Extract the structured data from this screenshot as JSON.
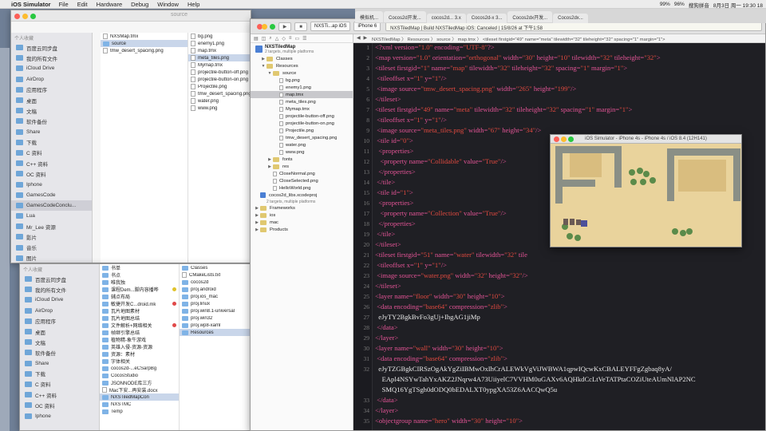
{
  "menubar": {
    "app_name": "iOS Simulator",
    "items": [
      "File",
      "Edit",
      "Hardware",
      "Debug",
      "Window",
      "Help"
    ],
    "status_right": [
      "99%",
      "96%",
      "搜狗拼音",
      "8月3日 周一 19:30 18"
    ]
  },
  "browser_tabs": [
    "模拟机...",
    "Cocos2d开发...",
    "cocos2d... 3.x",
    "Cocos2d-x 3...",
    "Cocos2dx开发...",
    "Cocos2dx..."
  ],
  "finder_top": {
    "title": "source",
    "sidebar_header": "个人收藏",
    "sidebar_items": [
      "百度云同步盘",
      "我的所有文件",
      "iCloud Drive",
      "AirDrop",
      "应用程序",
      "桌面",
      "文稿",
      "软件备份",
      "Share",
      "下载",
      "C 资料",
      "C++ 资料",
      "OC 资料",
      "Iphone",
      "GamesCode",
      "GamesCodeConclu...",
      "Lua",
      "Mr_Lee 资源",
      "影片",
      "音乐",
      "图片",
      "nixinsheng"
    ],
    "col1": [
      "NXSMap.tmx",
      "source",
      "tmw_desert_spacing.png"
    ],
    "col2": [
      "bg.png",
      "enemy1.png",
      "map.tmx",
      "meta_tiles.png",
      "Mymap.tmx",
      "projectile-button-off.png",
      "projectile-button-on.png",
      "Projectile.png",
      "tmw_desert_spacing.png",
      "water.png",
      "www.png"
    ]
  },
  "finder_bottom": {
    "sidebar_header": "个人收藏",
    "sidebar_items": [
      "百度云同步盘",
      "我的所有文件",
      "iCloud Drive",
      "AirDrop",
      "应用程序",
      "桌面",
      "文稿",
      "软件备份",
      "Share",
      "下载",
      "C 资料",
      "C++ 资料",
      "OC 资料",
      "Iphone"
    ],
    "col1": [
      "书单",
      "书点",
      "唯我独",
      "课程Dem...脚内容播哗",
      "辅点布局",
      "敏捷开发C...droid.mk",
      "瓦片地图素材",
      "瓦片地图总结",
      "文件解析+网络相关",
      "帧继引擎总结",
      "植物精-象牛游戏",
      "英雄入侵-资源-资源",
      "资源：素材",
      "字体相关",
      "cocos2d-...eCSarpBg",
      "CocosStudio",
      "JSONNODE库三方",
      "Mac下安...再安装.docx",
      "NXSTiledMapCon",
      "NXSTMC",
      "Temp"
    ],
    "col2": [
      "Classes",
      "CMakeLists.txt",
      "cocos2d",
      "proj.android",
      "proj.ios_mac",
      "proj.linux",
      "proj.win8.1-universal",
      "proj.win32",
      "proj.wp8-xaml",
      "Resources"
    ]
  },
  "xcode": {
    "scheme": "NXSTi...ap iOS",
    "device": "iPhone 6",
    "status": "NXSTiledMap  |  Build NXSTiledMap iOS: Canceled  |  15/8/26 at 下午1:58",
    "breadcrumb": "NXSTiledMap 〉 Resources 〉 source 〉 map.tmx 〉 <tileset firstgid=\"49\" name=\"meta\" tilewidth=\"32\" tileheight=\"32\" spacing=\"1\" margin=\"1\">",
    "project_name": "NXSTiledMap",
    "project_sub": "2 targets, multiple platforms",
    "nav": [
      {
        "label": "Classes",
        "depth": 1,
        "type": "folder",
        "open": false
      },
      {
        "label": "Resources",
        "depth": 1,
        "type": "folder",
        "open": true
      },
      {
        "label": "source",
        "depth": 2,
        "type": "folder",
        "open": true
      },
      {
        "label": "bg.png",
        "depth": 3,
        "type": "file"
      },
      {
        "label": "enemy1.png",
        "depth": 3,
        "type": "file"
      },
      {
        "label": "map.tmx",
        "depth": 3,
        "type": "file",
        "sel": true
      },
      {
        "label": "meta_tiles.png",
        "depth": 3,
        "type": "file"
      },
      {
        "label": "Mymap.tmx",
        "depth": 3,
        "type": "file"
      },
      {
        "label": "projectile-button-off.png",
        "depth": 3,
        "type": "file"
      },
      {
        "label": "projectile-button-on.png",
        "depth": 3,
        "type": "file"
      },
      {
        "label": "Projectile.png",
        "depth": 3,
        "type": "file"
      },
      {
        "label": "tmw_desert_spacing.png",
        "depth": 3,
        "type": "file"
      },
      {
        "label": "water.png",
        "depth": 3,
        "type": "file"
      },
      {
        "label": "www.png",
        "depth": 3,
        "type": "file"
      },
      {
        "label": "fonts",
        "depth": 2,
        "type": "folder",
        "open": false
      },
      {
        "label": "res",
        "depth": 2,
        "type": "folder",
        "open": false
      },
      {
        "label": "CloseNormal.png",
        "depth": 2,
        "type": "file"
      },
      {
        "label": "CloseSelected.png",
        "depth": 2,
        "type": "file"
      },
      {
        "label": "HelloWorld.png",
        "depth": 2,
        "type": "file"
      },
      {
        "label": "cocos2d_libs.xcodeproj",
        "depth": 0,
        "type": "project",
        "sub": "2 targets, multiple platforms"
      },
      {
        "label": "Frameworks",
        "depth": 0,
        "type": "folder",
        "open": false
      },
      {
        "label": "ios",
        "depth": 0,
        "type": "folder",
        "open": false
      },
      {
        "label": "mac",
        "depth": 0,
        "type": "folder",
        "open": false
      },
      {
        "label": "Products",
        "depth": 0,
        "type": "folder",
        "open": false
      }
    ],
    "code_lines": [
      {
        "n": "1",
        "h": "<span class='t'>&lt;?xml</span> <span class='a'>version=</span><span class='s'>\"1.0\"</span> <span class='a'>encoding=</span><span class='s'>\"UTF-8\"</span><span class='t'>?&gt;</span>"
      },
      {
        "n": "2",
        "h": "<span class='t'>&lt;map</span> <span class='a'>version=</span><span class='s'>\"1.0\"</span> <span class='a'>orientation=</span><span class='s'>\"orthogonal\"</span> <span class='a'>width=</span><span class='s'>\"30\"</span> <span class='a'>height=</span><span class='s'>\"10\"</span> <span class='a'>tilewidth=</span><span class='s'>\"32\"</span> <span class='a'>tileheight=</span><span class='s'>\"32\"</span><span class='t'>&gt;</span>"
      },
      {
        "n": "3",
        "h": "<span class='t'>&lt;tileset</span> <span class='a'>firstgid=</span><span class='s'>\"1\"</span> <span class='a'>name=</span><span class='s'>\"map\"</span> <span class='a'>tilewidth=</span><span class='s'>\"32\"</span> <span class='a'>tileheight=</span><span class='s'>\"32\"</span> <span class='a'>spacing=</span><span class='s'>\"1\"</span> <span class='a'>margin=</span><span class='s'>\"1\"</span><span class='t'>&gt;</span>"
      },
      {
        "n": "4",
        "h": "&nbsp;<span class='t'>&lt;tileoffset</span> <span class='a'>x=</span><span class='s'>\"1\"</span> <span class='a'>y=</span><span class='s'>\"1\"</span><span class='t'>/&gt;</span>"
      },
      {
        "n": "5",
        "h": "&nbsp;<span class='t'>&lt;image</span> <span class='a'>source=</span><span class='s'>\"tmw_desert_spacing.png\"</span> <span class='a'>width=</span><span class='s'>\"265\"</span> <span class='a'>height=</span><span class='s'>\"199\"</span><span class='t'>/&gt;</span>"
      },
      {
        "n": "6",
        "h": "<span class='t'>&lt;/tileset&gt;</span>"
      },
      {
        "n": "7",
        "h": "<span class='t'>&lt;tileset</span> <span class='a'>firstgid=</span><span class='s'>\"49\"</span> <span class='a'>name=</span><span class='s'>\"meta\"</span> <span class='a'>tilewidth=</span><span class='s'>\"32\"</span> <span class='a'>tileheight=</span><span class='s'>\"32\"</span> <span class='a'>spacing=</span><span class='s'>\"1\"</span> <span class='a'>margin=</span><span class='s'>\"1\"</span><span class='t'>&gt;</span>"
      },
      {
        "n": "8",
        "h": "&nbsp;<span class='t'>&lt;tileoffset</span> <span class='a'>x=</span><span class='s'>\"1\"</span> <span class='a'>y=</span><span class='s'>\"1\"</span><span class='t'>/&gt;</span>"
      },
      {
        "n": "9",
        "h": "&nbsp;<span class='t'>&lt;image</span> <span class='a'>source=</span><span class='s'>\"meta_tiles.png\"</span> <span class='a'>width=</span><span class='s'>\"67\"</span> <span class='a'>height=</span><span class='s'>\"34\"</span><span class='t'>/&gt;</span>"
      },
      {
        "n": "10",
        "h": "&nbsp;<span class='t'>&lt;tile</span> <span class='a'>id=</span><span class='s'>\"0\"</span><span class='t'>&gt;</span>"
      },
      {
        "n": "11",
        "h": "&nbsp;&nbsp;<span class='t'>&lt;properties&gt;</span>"
      },
      {
        "n": "12",
        "h": "&nbsp;&nbsp;&nbsp;<span class='t'>&lt;property</span> <span class='a'>name=</span><span class='s'>\"Collidable\"</span> <span class='a'>value=</span><span class='s'>\"True\"</span><span class='t'>/&gt;</span>"
      },
      {
        "n": "13",
        "h": "&nbsp;&nbsp;<span class='t'>&lt;/properties&gt;</span>"
      },
      {
        "n": "14",
        "h": "&nbsp;<span class='t'>&lt;/tile&gt;</span>"
      },
      {
        "n": "15",
        "h": "&nbsp;<span class='t'>&lt;tile</span> <span class='a'>id=</span><span class='s'>\"1\"</span><span class='t'>&gt;</span>"
      },
      {
        "n": "16",
        "h": "&nbsp;&nbsp;<span class='t'>&lt;properties&gt;</span>"
      },
      {
        "n": "17",
        "h": "&nbsp;&nbsp;&nbsp;<span class='t'>&lt;property</span> <span class='a'>name=</span><span class='s'>\"Collection\"</span> <span class='a'>value=</span><span class='s'>\"True\"</span><span class='t'>/&gt;</span>"
      },
      {
        "n": "18",
        "h": "&nbsp;&nbsp;<span class='t'>&lt;/properties&gt;</span>"
      },
      {
        "n": "19",
        "h": "&nbsp;<span class='t'>&lt;/tile&gt;</span>"
      },
      {
        "n": "20",
        "h": "<span class='t'>&lt;/tileset&gt;</span>"
      },
      {
        "n": "21",
        "h": "<span class='t'>&lt;tileset</span> <span class='a'>firstgid=</span><span class='s'>\"51\"</span> <span class='a'>name=</span><span class='s'>\"water\"</span> <span class='a'>tilewidth=</span><span class='s'>\"32\"</span> <span class='a'>tile</span>"
      },
      {
        "n": "22",
        "h": "&nbsp;<span class='t'>&lt;tileoffset</span> <span class='a'>x=</span><span class='s'>\"1\"</span> <span class='a'>y=</span><span class='s'>\"1\"</span><span class='t'>/&gt;</span>"
      },
      {
        "n": "23",
        "h": "&nbsp;<span class='t'>&lt;image</span> <span class='a'>source=</span><span class='s'>\"water.png\"</span> <span class='a'>width=</span><span class='s'>\"32\"</span> <span class='a'>height=</span><span class='s'>\"32\"</span><span class='t'>/&gt;</span>"
      },
      {
        "n": "24",
        "h": "<span class='t'>&lt;/tileset&gt;</span>"
      },
      {
        "n": "25",
        "h": "<span class='t'>&lt;layer</span> <span class='a'>name=</span><span class='s'>\"floor\"</span> <span class='a'>width=</span><span class='s'>\"30\"</span> <span class='a'>height=</span><span class='s'>\"10\"</span><span class='t'>&gt;</span>"
      },
      {
        "n": "26",
        "h": "&nbsp;<span class='t'>&lt;data</span> <span class='a'>encoding=</span><span class='s'>\"base64\"</span> <span class='a'>compression=</span><span class='s'>\"zlib\"</span><span class='t'>&gt;</span>"
      },
      {
        "n": "27",
        "h": "&nbsp;&nbsp;<span class='p'>eJyTY2BgkBvFo3gUj+IhgAG1jiMp</span>"
      },
      {
        "n": "28",
        "h": "&nbsp;<span class='t'>&lt;/data&gt;</span>"
      },
      {
        "n": "29",
        "h": "<span class='t'>&lt;/layer&gt;</span>"
      },
      {
        "n": "30",
        "h": "<span class='t'>&lt;layer</span> <span class='a'>name=</span><span class='s'>\"wall\"</span> <span class='a'>width=</span><span class='s'>\"30\"</span> <span class='a'>height=</span><span class='s'>\"10\"</span><span class='t'>&gt;</span>"
      },
      {
        "n": "31",
        "h": "&nbsp;<span class='t'>&lt;data</span> <span class='a'>encoding=</span><span class='s'>\"base64\"</span> <span class='a'>compression=</span><span class='s'>\"zlib\"</span><span class='t'>&gt;</span>"
      },
      {
        "n": "32",
        "h": "&nbsp;&nbsp;<span class='p'>eJyTZGBgkCIRSzOgAkYgZiIBMwOxIhCrALEWkVgViJWBWA1qpwIQcwKxCBALEYFFgZgbaq8yA/</span>"
      },
      {
        "n": "",
        "h": "&nbsp;&nbsp;&nbsp;&nbsp;<span class='p'>EApl4NSYwTahYxAKZ2JNqrw4A73UiiyelC7VVHM0uGAXv6AQHkdCcLtVeTATPtaCOZiUteAUmNlAP2NC</span>"
      },
      {
        "n": "",
        "h": "&nbsp;&nbsp;&nbsp;&nbsp;<span class='p'>SMQ16YgTSgh0dODQ0bEDALXT0ypgXA53Z6AACQwQ5u</span>"
      },
      {
        "n": "33",
        "h": "&nbsp;<span class='t'>&lt;/data&gt;</span>"
      },
      {
        "n": "34",
        "h": "<span class='t'>&lt;/layer&gt;</span>"
      },
      {
        "n": "35",
        "h": "<span class='t'>&lt;objectgroup</span> <span class='a'>name=</span><span class='s'>\"hero\"</span> <span class='a'>width=</span><span class='s'>\"30\"</span> <span class='a'>height=</span><span class='s'>\"10\"</span><span class='t'>&gt;</span>"
      }
    ]
  },
  "simulator": {
    "title": "iOS Simulator - iPhone 4s - iPhone 4s / iOS 8.4 (12H141)"
  },
  "colors": {
    "tag": "#e45496",
    "string": "#e0493f",
    "editor_bg": "#1f1f24",
    "sand": "#e6cf98"
  }
}
